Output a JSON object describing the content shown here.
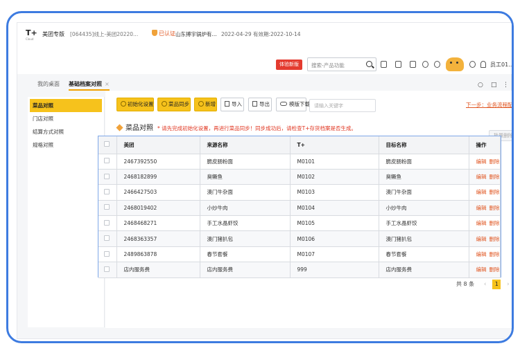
{
  "app": {
    "logo": "T+",
    "logo_sub": "Cloud",
    "product": "美团专版",
    "company": "[064435]线上-美团20220...",
    "verified": "已认证",
    "org": "山东搏宇锅炉有...",
    "dates": "2022-04-29  有效期:2022-10-14",
    "experience_button": "体验新版",
    "search_placeholder": "搜索-产品功能",
    "user": "员工01..."
  },
  "tabs": [
    {
      "label": "我的桌面",
      "active": false
    },
    {
      "label": "基础档案对照",
      "active": true,
      "close": "×"
    }
  ],
  "sidebar": {
    "items": [
      {
        "label": "菜品对照",
        "active": true
      },
      {
        "label": "门店对照",
        "active": false
      },
      {
        "label": "结算方式对照",
        "active": false
      },
      {
        "label": "规格对照",
        "active": false
      }
    ]
  },
  "toolbar": {
    "init": "初始化设置",
    "sync": "菜品同步",
    "add": "新增",
    "import": "导入",
    "export": "导出",
    "template": "模版下载",
    "keyword_placeholder": "请输入关键字",
    "next_link": "下一步：业务流程配置>>"
  },
  "section": {
    "title": "菜品对照",
    "warning": "* 请先完成初始化设置，再进行菜品同步！同步成功后，请检查T+存货档案是否生成。",
    "bulk_delete": "批量删除"
  },
  "table": {
    "columns": [
      "美团",
      "来源名称",
      "T+",
      "目标名称",
      "操作"
    ],
    "rows": [
      [
        "2467392550",
        "脆皮肠粉面",
        "M0101",
        "脆皮肠粉面"
      ],
      [
        "2468182899",
        "臭鳜鱼",
        "M0102",
        "臭鳜鱼"
      ],
      [
        "2466427503",
        "澳门牛杂面",
        "M0103",
        "澳门牛杂面"
      ],
      [
        "2468019402",
        "小炒牛肉",
        "M0104",
        "小炒牛肉"
      ],
      [
        "2468468271",
        "手工水晶虾饺",
        "M0105",
        "手工水晶虾饺"
      ],
      [
        "2468363357",
        "澳门猪扒包",
        "M0106",
        "澳门猪扒包"
      ],
      [
        "2489863878",
        "春节套餐",
        "M0107",
        "春节套餐"
      ],
      [
        "店内服务费",
        "店内服务费",
        "999",
        "店内服务费"
      ]
    ],
    "actions": {
      "edit": "编辑",
      "delete": "删除"
    }
  },
  "pager": {
    "total": "共 8 条",
    "prev": "‹",
    "page": "1",
    "next": "›"
  },
  "colors": {
    "accent": "#f6c21c",
    "danger": "#e43b2f",
    "link": "#e0541f",
    "frame": "#3d7be0"
  },
  "icons": [
    "search-icon",
    "phone-icon",
    "message-icon",
    "monitor-icon",
    "bell-icon",
    "call-icon",
    "mascot-icon",
    "help-icon",
    "user-icon",
    "cube-icon",
    "checkbox-icon"
  ]
}
